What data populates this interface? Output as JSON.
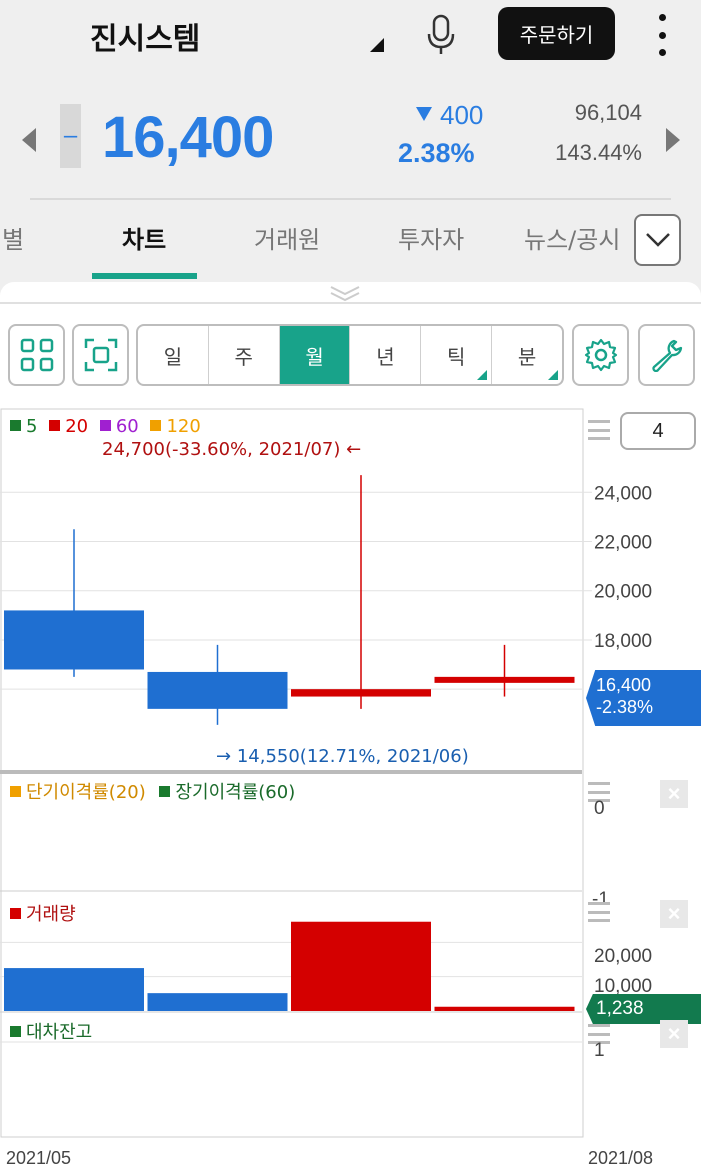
{
  "header": {
    "stock_name": "진시스템",
    "order_button": "주문하기"
  },
  "quote": {
    "flat_sign": "–",
    "price": "16,400",
    "change": "400",
    "change_rate": "2.38%",
    "volume": "96,104",
    "volume_ratio": "143.44%"
  },
  "tabs": [
    {
      "label": "별",
      "active": false
    },
    {
      "label": "차트",
      "active": true
    },
    {
      "label": "거래원",
      "active": false
    },
    {
      "label": "투자자",
      "active": false
    },
    {
      "label": "뉴스/공시",
      "active": false
    }
  ],
  "toolbar": {
    "periods": [
      {
        "label": "일",
        "active": false,
        "submenu": false
      },
      {
        "label": "주",
        "active": false,
        "submenu": false
      },
      {
        "label": "월",
        "active": true,
        "submenu": false
      },
      {
        "label": "년",
        "active": false,
        "submenu": false
      },
      {
        "label": "틱",
        "active": false,
        "submenu": true
      },
      {
        "label": "분",
        "active": false,
        "submenu": true
      }
    ]
  },
  "chart": {
    "count": "4",
    "ma_legend": [
      {
        "label": "5",
        "color": "#1a7a2e"
      },
      {
        "label": "20",
        "color": "#d40000"
      },
      {
        "label": "60",
        "color": "#a020d0"
      },
      {
        "label": "120",
        "color": "#f0a000"
      }
    ],
    "high_annotation": "24,700(-33.60%, 2021/07)",
    "low_annotation": "14,550(12.71%, 2021/06)",
    "current_price_tag": "16,400",
    "current_rate_tag": "-2.38%",
    "disparity_legend": [
      {
        "label": "단기이격률(20)",
        "color": "#f0a000"
      },
      {
        "label": "장기이격률(60)",
        "color": "#1a7a2e"
      }
    ],
    "disparity_axis": [
      "0",
      "-1"
    ],
    "volume_legend": "거래량",
    "volume_axis": [
      "20,000",
      "10,000"
    ],
    "volume_tag": "1,238",
    "loan_legend": "대차잔고",
    "loan_axis": [
      "1"
    ],
    "x_start": "2021/05",
    "x_end": "2021/08",
    "colors": {
      "up": "#d40000",
      "down": "#1f6fd1",
      "accent": "#18a38a"
    }
  },
  "chart_data": {
    "type": "candlestick",
    "x": [
      "2021/05",
      "2021/06",
      "2021/07",
      "2021/08"
    ],
    "open": [
      19200,
      16700,
      15700,
      16300
    ],
    "high": [
      22500,
      17800,
      24700,
      17800
    ],
    "low": [
      16500,
      14550,
      15200,
      15700
    ],
    "close": [
      16800,
      15200,
      16000,
      16500
    ],
    "ylim": [
      13000,
      25800
    ],
    "yticks": [
      "24,000",
      "22,000",
      "20,000",
      "18,000"
    ],
    "volume": [
      12500,
      5200,
      26000,
      1238
    ],
    "volume_ylim": [
      0,
      30000
    ]
  }
}
